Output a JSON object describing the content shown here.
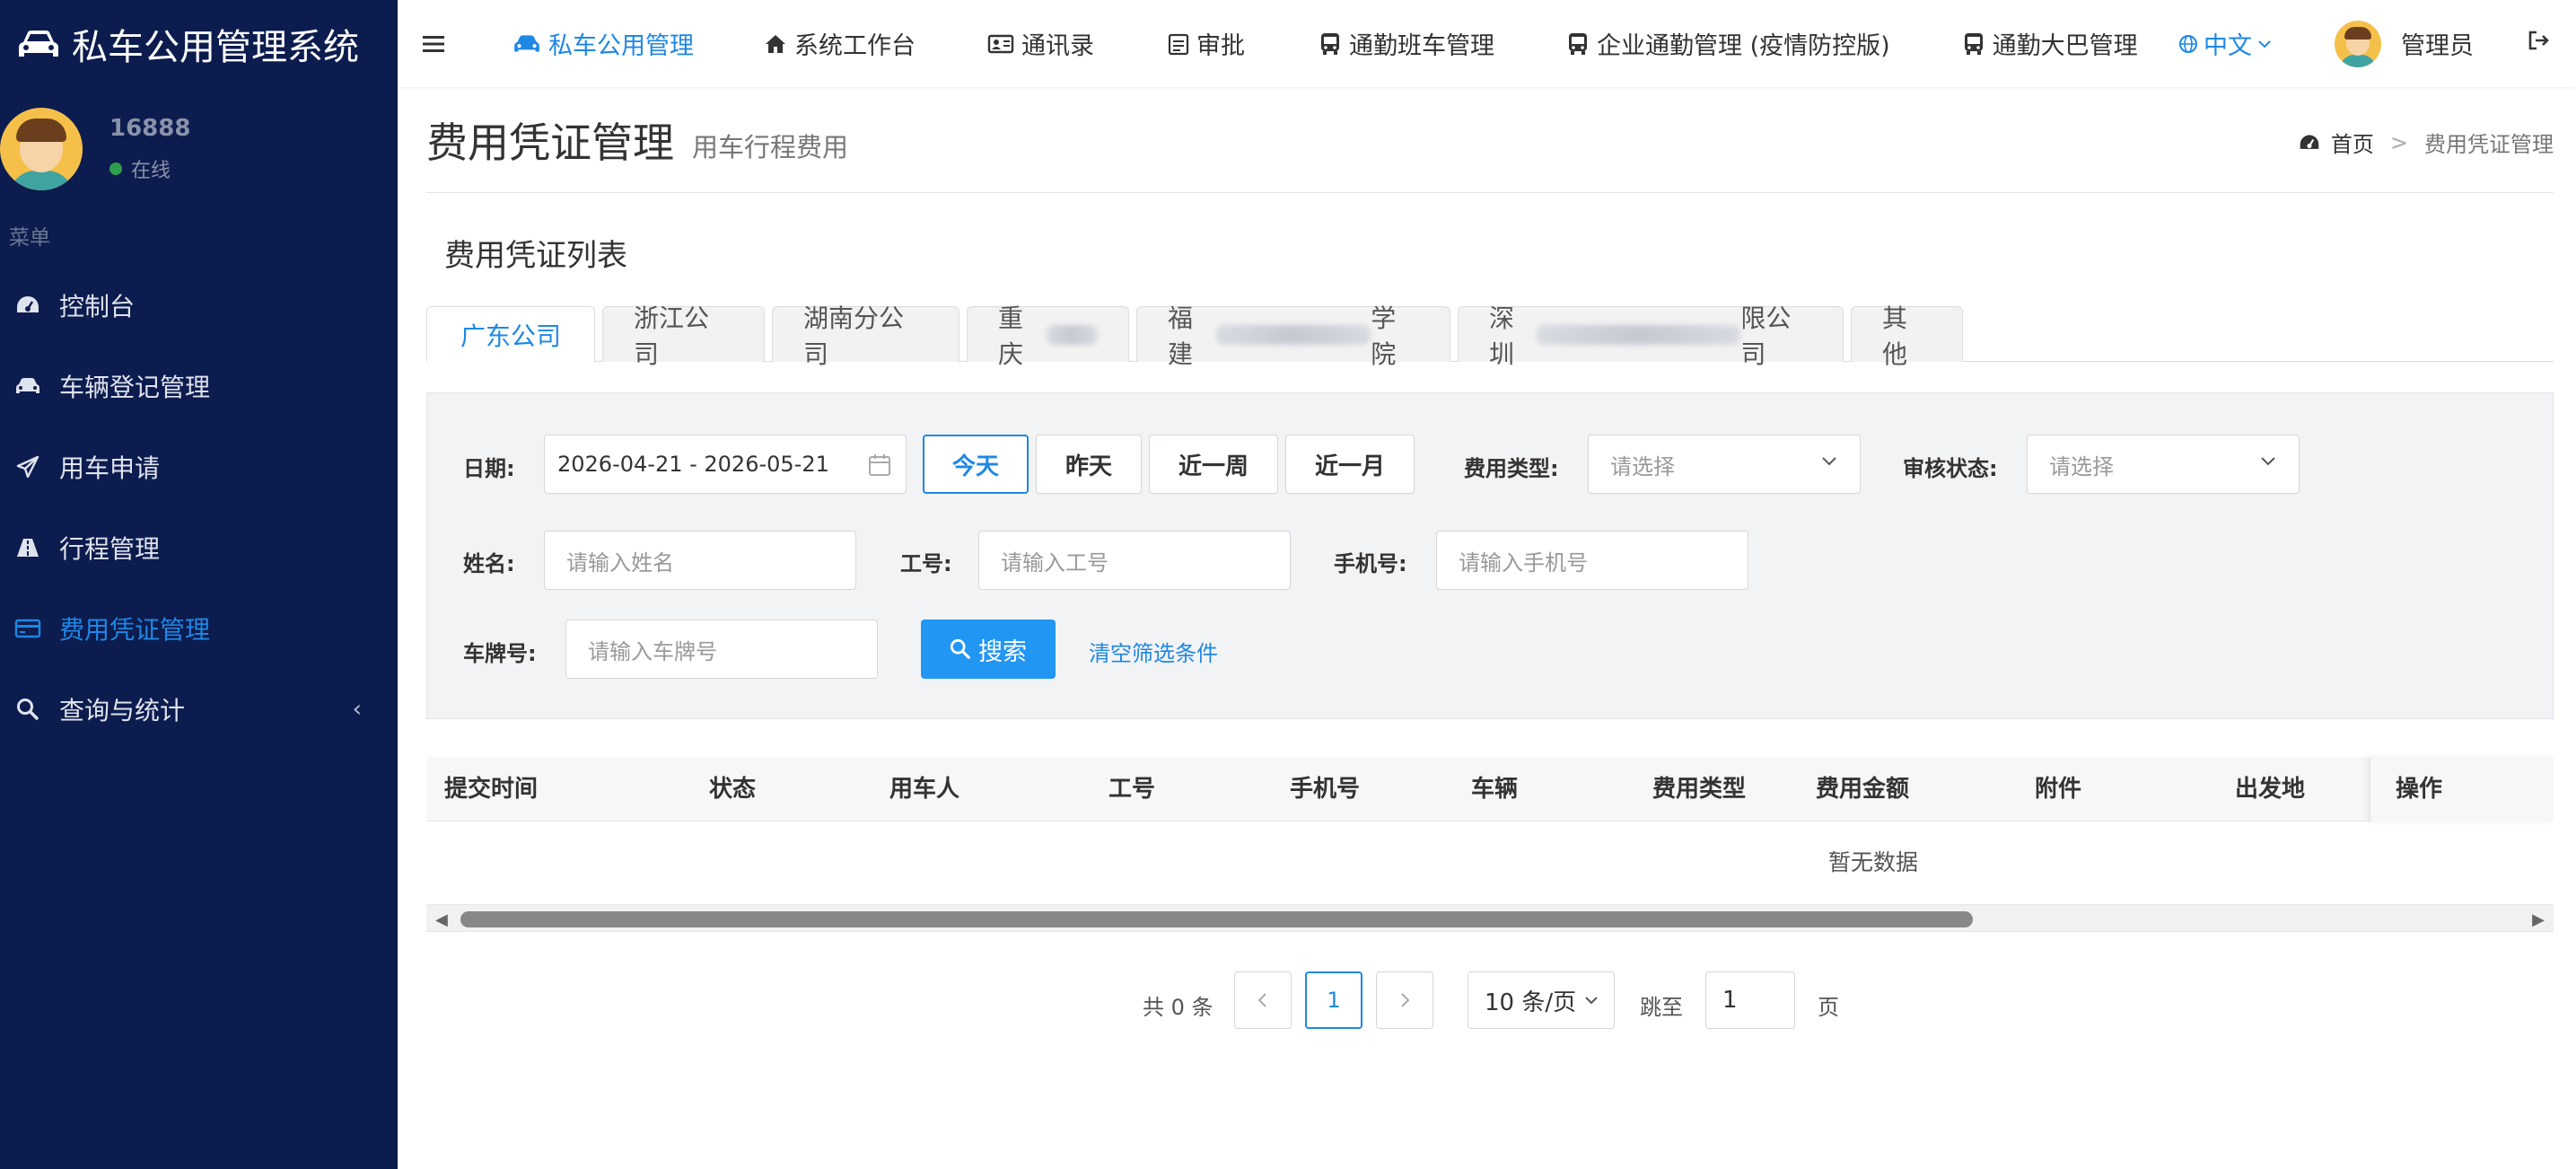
{
  "app": {
    "title": "私车公用管理系统"
  },
  "user": {
    "id": "16888",
    "status": "在线"
  },
  "sidebar": {
    "menu_title": "菜单",
    "items": [
      {
        "label": "控制台",
        "icon": "dashboard-icon"
      },
      {
        "label": "车辆登记管理",
        "icon": "car-icon"
      },
      {
        "label": "用车申请",
        "icon": "send-icon"
      },
      {
        "label": "行程管理",
        "icon": "road-icon"
      },
      {
        "label": "费用凭证管理",
        "icon": "credit-card-icon",
        "active": true
      },
      {
        "label": "查询与统计",
        "icon": "search-icon",
        "has_submenu": true
      }
    ]
  },
  "topnav": {
    "items": [
      {
        "label": "私车公用管理",
        "active": true
      },
      {
        "label": "系统工作台"
      },
      {
        "label": "通讯录"
      },
      {
        "label": "审批"
      },
      {
        "label": "通勤班车管理"
      },
      {
        "label": "企业通勤管理 (疫情防控版)"
      },
      {
        "label": "通勤大巴管理"
      }
    ],
    "language": "中文",
    "admin": "管理员"
  },
  "page": {
    "title": "费用凭证管理",
    "subtitle": "用车行程费用",
    "breadcrumb": {
      "home": "首页",
      "current": "费用凭证管理"
    }
  },
  "card": {
    "title": "费用凭证列表"
  },
  "tabs": [
    {
      "label": "广东公司",
      "active": true
    },
    {
      "label": "浙江公司"
    },
    {
      "label": "湖南分公司"
    },
    {
      "label": "重庆",
      "blurred": true
    },
    {
      "label_prefix": "福建",
      "label_suffix": "学院",
      "blurred": true
    },
    {
      "label_prefix": "深圳",
      "label_suffix": "限公司",
      "blurred": true
    },
    {
      "label": "其他"
    }
  ],
  "filters": {
    "date_label": "日期:",
    "date_value": "2026-04-21 - 2026-05-21",
    "quick": [
      "今天",
      "昨天",
      "近一周",
      "近一月"
    ],
    "fee_type_label": "费用类型:",
    "fee_type_placeholder": "请选择",
    "audit_label": "审核状态:",
    "audit_placeholder": "请选择",
    "name_label": "姓名:",
    "name_placeholder": "请输入姓名",
    "empno_label": "工号:",
    "empno_placeholder": "请输入工号",
    "phone_label": "手机号:",
    "phone_placeholder": "请输入手机号",
    "plate_label": "车牌号:",
    "plate_placeholder": "请输入车牌号",
    "search_label": "搜索",
    "clear_label": "清空筛选条件"
  },
  "table": {
    "columns": [
      "提交时间",
      "状态",
      "用车人",
      "工号",
      "手机号",
      "车辆",
      "费用类型",
      "费用金额",
      "附件",
      "出发地"
    ],
    "op_column": "操作",
    "empty_text": "暂无数据"
  },
  "pagination": {
    "total": "共 0 条",
    "current_page": "1",
    "page_size": "10 条/页",
    "goto_label": "跳至",
    "goto_value": "1",
    "page_suffix": "页"
  },
  "colors": {
    "sidebar_bg": "#0c1c4e",
    "accent": "#1e88e5",
    "search_btn": "#2196f3"
  }
}
